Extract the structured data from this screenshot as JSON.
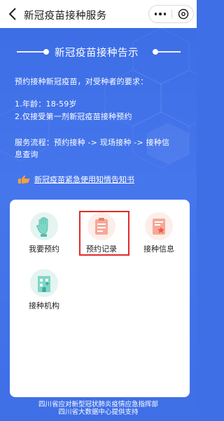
{
  "header": {
    "title": "新冠疫苗接种服务",
    "back_icon": "chevron-left-icon",
    "more_icon": "more-dots-icon",
    "close_icon": "close-circle-icon"
  },
  "notice": {
    "title": "新冠疫苗接种告示",
    "intro": "预约接种新冠疫苗，对受种者的要求：",
    "req1": "1.年龄：18-59岁",
    "req2": "2.仅接受第一剂新冠疫苗接种预约",
    "flow_line1": "服务流程：预约接种 -> 现场接种 -> 接种信",
    "flow_line2": "息查询",
    "link_text": "新冠疫苗紧急使用知情告知书",
    "link_icon": "pointing-hand-icon"
  },
  "services": [
    {
      "label": "我要预约",
      "icon": "glove-hand-icon"
    },
    {
      "label": "预约记录",
      "icon": "clipboard-icon"
    },
    {
      "label": "接种信息",
      "icon": "certificate-icon"
    },
    {
      "label": "接种机构",
      "icon": "hospital-icon"
    }
  ],
  "footer": {
    "line1": "四川省应对新型冠状肺炎疫情应急指挥部",
    "line2": "四川省大数据中心提供支持"
  },
  "colors": {
    "primary_blue": "#3f6fe6",
    "highlight_red": "#e12a2a",
    "link_icon_orange": "#f4a23c"
  }
}
